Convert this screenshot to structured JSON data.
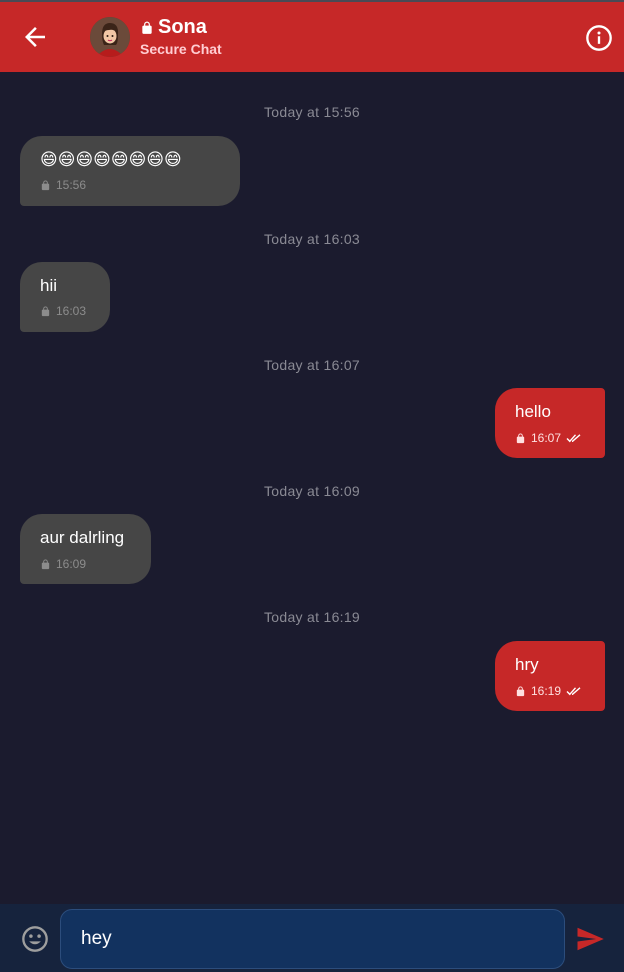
{
  "header": {
    "title": "Sona",
    "subtitle": "Secure Chat",
    "icons": {
      "back": "arrow-left-icon",
      "lock": "lock-icon",
      "info": "info-circle-icon"
    },
    "background": "#c62828"
  },
  "messages": [
    {
      "date": "Today at 15:56",
      "direction": "incoming",
      "text": "😄😄😄😄😄😄😄😄",
      "time": "15:56"
    },
    {
      "date": "Today at 16:03",
      "direction": "incoming",
      "text": "hii",
      "time": "16:03"
    },
    {
      "date": "Today at 16:07",
      "direction": "outgoing",
      "text": "hello",
      "time": "16:07"
    },
    {
      "date": "Today at 16:09",
      "direction": "incoming",
      "text": "aur dalrling",
      "time": "16:09"
    },
    {
      "date": "Today at 16:19",
      "direction": "outgoing",
      "text": "hry",
      "time": "16:19"
    }
  ],
  "composer": {
    "value": "hey",
    "icons": {
      "emoji": "emoji-icon",
      "send": "send-icon"
    }
  },
  "colors": {
    "background": "#1b1b2e",
    "incoming_bubble": "#464646",
    "outgoing_bubble": "#c62828",
    "composer_bar": "#16233d",
    "input_field": "#12325f"
  }
}
